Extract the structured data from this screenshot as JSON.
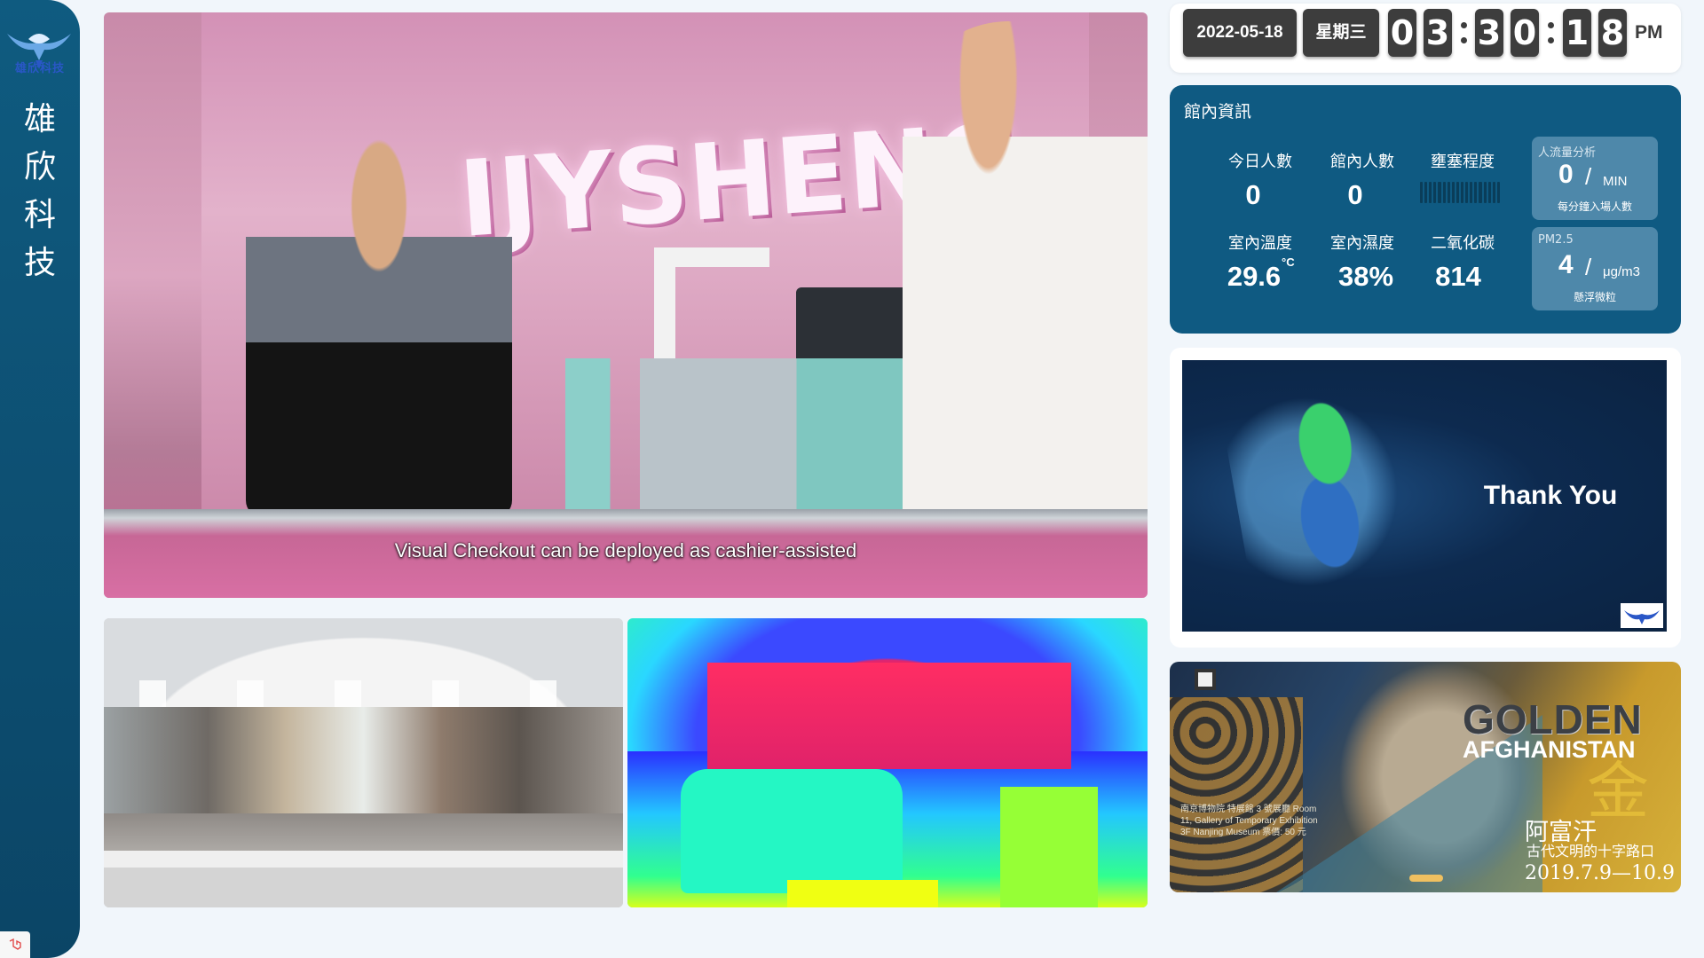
{
  "sidebar": {
    "logo_text": "雄欣科技",
    "brand_chars": [
      "雄",
      "欣",
      "科",
      "技"
    ]
  },
  "main_video": {
    "subtitle": "Visual Checkout can be deployed as cashier-assisted"
  },
  "clock": {
    "date": "2022-05-18",
    "weekday": "星期三",
    "digits": [
      "0",
      "3",
      "3",
      "0",
      "1",
      "8"
    ],
    "ampm": "PM"
  },
  "info": {
    "title": "館內資訊",
    "today_count_label": "今日人數",
    "today_count": "0",
    "inside_count_label": "館內人數",
    "inside_count": "0",
    "congestion_label": "壅塞程度",
    "temperature_label": "室內溫度",
    "temperature": "29.6",
    "temperature_unit": "°C",
    "humidity_label": "室內濕度",
    "humidity": "38%",
    "co2_label": "二氧化碳",
    "co2": "814",
    "flow_card": {
      "title": "人流量分析",
      "value": "0",
      "slash": "/",
      "unit": "MIN",
      "subtitle": "每分鐘入場人數"
    },
    "pm_card": {
      "title": "PM2.5",
      "value": "4",
      "slash": "/",
      "unit": "μg/m3",
      "subtitle": "懸浮微粒"
    }
  },
  "slide": {
    "text": "Thank You"
  },
  "poster": {
    "title_line1": "GOLDEN",
    "title_line2": "AFGHANISTAN",
    "cn_title": "阿富汗",
    "cn_subtitle": "古代文明的十字路口",
    "date": "2019.7.9—10.9",
    "gold_char": "金",
    "details": "南京博物院 特展館 3 號展廳 Room 11, Gallery of Temporary Exhibition 3F Nanjing Museum 票價: 50 元"
  },
  "colors": {
    "sidebar": "#0f5b80",
    "info_card": "#0f5a82",
    "digit_bg": "#3d3d3d",
    "page_bg": "#f1f6fb"
  }
}
